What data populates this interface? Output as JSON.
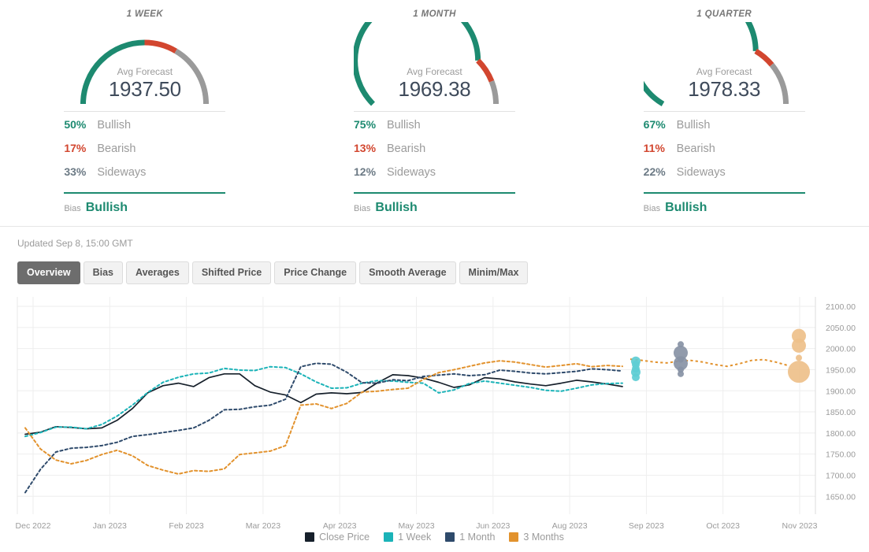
{
  "gauges": [
    {
      "title": "1 WEEK",
      "avg_label": "Avg Forecast",
      "avg_value": "1937.50",
      "bullish_pct": "50%",
      "bullish_label": "Bullish",
      "bearish_pct": "17%",
      "bearish_label": "Bearish",
      "sideways_pct": "33%",
      "sideways_label": "Sideways",
      "bias_label": "Bias",
      "bias_value": "Bullish",
      "arc": {
        "green": 50,
        "red": 17,
        "gray": 33
      }
    },
    {
      "title": "1 MONTH",
      "avg_label": "Avg Forecast",
      "avg_value": "1969.38",
      "bullish_pct": "75%",
      "bullish_label": "Bullish",
      "bearish_pct": "13%",
      "bearish_label": "Bearish",
      "sideways_pct": "12%",
      "sideways_label": "Sideways",
      "bias_label": "Bias",
      "bias_value": "Bullish",
      "arc": {
        "green": 75,
        "red": 13,
        "gray": 12
      }
    },
    {
      "title": "1 QUARTER",
      "avg_label": "Avg Forecast",
      "avg_value": "1978.33",
      "bullish_pct": "67%",
      "bullish_label": "Bullish",
      "bearish_pct": "11%",
      "bearish_label": "Bearish",
      "sideways_pct": "22%",
      "sideways_label": "Sideways",
      "bias_label": "Bias",
      "bias_value": "Bullish",
      "arc": {
        "green": 67,
        "red": 11,
        "gray": 22
      }
    }
  ],
  "updated": "Updated Sep 8, 15:00 GMT",
  "tabs": [
    {
      "label": "Overview",
      "active": true
    },
    {
      "label": "Bias",
      "active": false
    },
    {
      "label": "Averages",
      "active": false
    },
    {
      "label": "Shifted Price",
      "active": false
    },
    {
      "label": "Price Change",
      "active": false
    },
    {
      "label": "Smooth Average",
      "active": false
    },
    {
      "label": "Minim/Max",
      "active": false
    }
  ],
  "colors": {
    "bullish": "#1d8a70",
    "bearish": "#d2462f",
    "neutral": "#9b9b9b",
    "close_price": "#16202b",
    "one_week": "#1bb3b8",
    "one_month": "#2e4a6b",
    "three_months": "#e2922d",
    "bubble_one_week": "#5ecdd4",
    "bubble_one_month": "#8892a5",
    "bubble_three_months": "#eec08a",
    "grid": "#eeeeee",
    "tab_active_bg": "#6d6d6d"
  },
  "chart_data": {
    "type": "line",
    "title": "",
    "xlabel": "",
    "ylabel": "",
    "grid": true,
    "legend_position": "bottom",
    "ylim": [
      1630,
      2115
    ],
    "yticks": [
      "1650.00",
      "1700.00",
      "1750.00",
      "1800.00",
      "1850.00",
      "1900.00",
      "1950.00",
      "2000.00",
      "2050.00",
      "2100.00"
    ],
    "xticks": [
      "Dec 2022",
      "Jan 2023",
      "Feb 2023",
      "Mar 2023",
      "Apr 2023",
      "May 2023",
      "Jun 2023",
      "Aug 2023",
      "Sep 2023",
      "Oct 2023",
      "Nov 2023"
    ],
    "legend": [
      {
        "name": "Close Price",
        "color": "#16202b",
        "style": "solid"
      },
      {
        "name": "1 Week",
        "color": "#1bb3b8",
        "style": "dotted"
      },
      {
        "name": "1 Month",
        "color": "#2e4a6b",
        "style": "dotted"
      },
      {
        "name": "3 Months",
        "color": "#e2922d",
        "style": "dotted"
      }
    ],
    "series": [
      {
        "name": "Close Price",
        "color": "#16202b",
        "style": "solid",
        "values": [
          1797,
          1802,
          1815,
          1813,
          1810,
          1812,
          1830,
          1858,
          1895,
          1912,
          1918,
          1910,
          1931,
          1940,
          1940,
          1912,
          1897,
          1890,
          1872,
          1892,
          1895,
          1893,
          1896,
          1919,
          1938,
          1936,
          1930,
          1920,
          1908,
          1914,
          1931,
          1928,
          1921,
          1916,
          1912,
          1918,
          1925,
          1921,
          1916,
          1910
        ]
      },
      {
        "name": "1 Week",
        "color": "#1bb3b8",
        "style": "dotted",
        "values": [
          1792,
          1801,
          1814,
          1814,
          1810,
          1820,
          1840,
          1866,
          1896,
          1920,
          1932,
          1940,
          1942,
          1953,
          1949,
          1948,
          1957,
          1955,
          1940,
          1921,
          1906,
          1907,
          1918,
          1924,
          1923,
          1920,
          1918,
          1895,
          1902,
          1917,
          1923,
          1918,
          1913,
          1908,
          1901,
          1899,
          1906,
          1914,
          1917,
          1918
        ]
      },
      {
        "name": "1 Month",
        "color": "#2e4a6b",
        "style": "dotted",
        "values": [
          1659,
          1714,
          1755,
          1764,
          1766,
          1770,
          1778,
          1792,
          1796,
          1801,
          1806,
          1812,
          1830,
          1855,
          1856,
          1862,
          1866,
          1880,
          1957,
          1965,
          1963,
          1944,
          1919,
          1918,
          1926,
          1924,
          1934,
          1937,
          1940,
          1936,
          1938,
          1949,
          1946,
          1942,
          1940,
          1943,
          1946,
          1952,
          1950,
          1947
        ]
      },
      {
        "name": "3 Months",
        "color": "#e2922d",
        "style": "dotted",
        "values": [
          1812,
          1762,
          1736,
          1727,
          1735,
          1749,
          1759,
          1746,
          1723,
          1712,
          1703,
          1711,
          1709,
          1715,
          1749,
          1753,
          1757,
          1770,
          1866,
          1869,
          1858,
          1870,
          1897,
          1899,
          1903,
          1906,
          1927,
          1943,
          1950,
          1958,
          1966,
          1971,
          1968,
          1962,
          1956,
          1960,
          1964,
          1957,
          1960,
          1958
        ]
      }
    ],
    "forecast_bubbles": [
      {
        "group": "1 Week",
        "color": "#5ecdd4",
        "points": [
          {
            "value": 1970,
            "size": 6
          },
          {
            "value": 1962,
            "size": 5
          },
          {
            "value": 1952,
            "size": 5
          },
          {
            "value": 1944,
            "size": 6
          },
          {
            "value": 1932,
            "size": 5
          }
        ]
      },
      {
        "group": "1 Month",
        "color": "#8892a5",
        "points": [
          {
            "value": 2010,
            "size": 4
          },
          {
            "value": 1990,
            "size": 9
          },
          {
            "value": 1974,
            "size": 4
          },
          {
            "value": 1965,
            "size": 9
          },
          {
            "value": 1950,
            "size": 4
          },
          {
            "value": 1940,
            "size": 4
          }
        ]
      },
      {
        "group": "3 Months",
        "color": "#eec08a",
        "points": [
          {
            "value": 2030,
            "size": 9
          },
          {
            "value": 2007,
            "size": 9
          },
          {
            "value": 1978,
            "size": 4
          },
          {
            "value": 1945,
            "size": 14
          }
        ]
      }
    ]
  }
}
